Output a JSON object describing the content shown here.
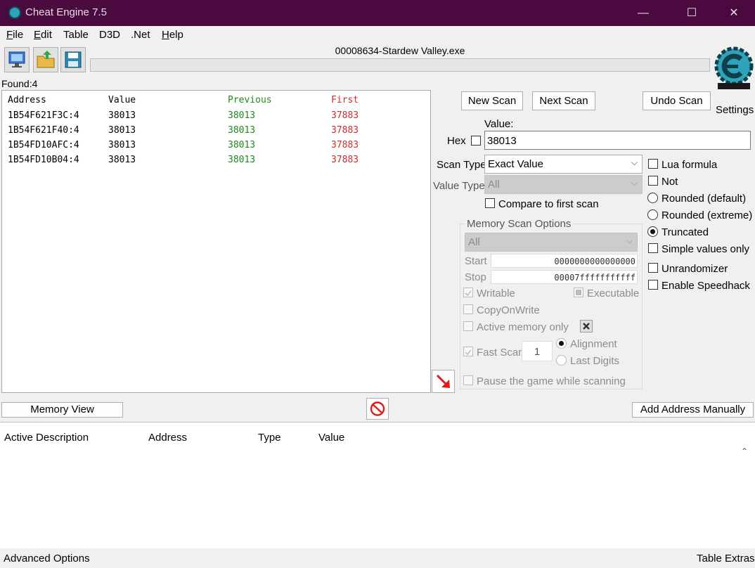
{
  "window": {
    "title": "Cheat Engine 7.5",
    "minimize": "—",
    "maximize": "☐",
    "close": "✕"
  },
  "menu": [
    {
      "u": "F",
      "rest": "ile"
    },
    {
      "u": "E",
      "rest": "dit"
    },
    {
      "u": "",
      "rest": "Table"
    },
    {
      "u": "",
      "rest": "D3D"
    },
    {
      "u": "",
      "rest": ".Net"
    },
    {
      "u": "H",
      "rest": "elp"
    }
  ],
  "process": "00008634-Stardew Valley.exe",
  "found_label": "Found:4",
  "settings_label": "Settings",
  "results": {
    "headers": {
      "address": "Address",
      "value": "Value",
      "previous": "Previous",
      "first": "First"
    },
    "rows": [
      {
        "address": "1B54F621F3C:4",
        "value": "38013",
        "previous": "38013",
        "first": "37883"
      },
      {
        "address": "1B54F621F40:4",
        "value": "38013",
        "previous": "38013",
        "first": "37883"
      },
      {
        "address": "1B54FD10AFC:4",
        "value": "38013",
        "previous": "38013",
        "first": "37883"
      },
      {
        "address": "1B54FD10B04:4",
        "value": "38013",
        "previous": "38013",
        "first": "37883"
      }
    ]
  },
  "scan": {
    "new_scan": "New Scan",
    "next_scan": "Next Scan",
    "undo_scan": "Undo Scan",
    "value_label": "Value:",
    "hex_label": "Hex",
    "value": "38013",
    "scan_type_label": "Scan Type",
    "scan_type": "Exact Value",
    "value_type_label": "Value Type",
    "value_type": "All",
    "compare_first": "Compare to first scan"
  },
  "memory_options": {
    "title": "Memory Scan Options",
    "region": "All",
    "start_label": "Start",
    "start": "0000000000000000",
    "stop_label": "Stop",
    "stop": "00007fffffffffff",
    "writable": "Writable",
    "executable": "Executable",
    "copy_on_write": "CopyOnWrite",
    "active_memory": "Active memory only",
    "fast_scan": "Fast Scan",
    "fast_scan_value": "1",
    "alignment": "Alignment",
    "last_digits": "Last Digits",
    "pause_game": "Pause the game while scanning"
  },
  "right_options": {
    "lua_formula": "Lua formula",
    "not": "Not",
    "rounded_default": "Rounded (default)",
    "rounded_extreme": "Rounded (extreme)",
    "truncated": "Truncated",
    "simple_values": "Simple values only",
    "unrandomizer": "Unrandomizer",
    "speedhack": "Enable Speedhack"
  },
  "bottom": {
    "memory_view": "Memory View",
    "add_address": "Add Address Manually",
    "advanced_options": "Advanced Options",
    "table_extras": "Table Extras"
  },
  "address_table": {
    "headers": {
      "active_description": "Active Description",
      "address": "Address",
      "type": "Type",
      "value": "Value"
    }
  }
}
